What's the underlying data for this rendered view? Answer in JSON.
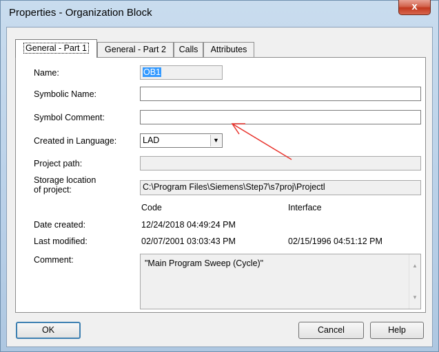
{
  "window": {
    "title": "Properties - Organization Block",
    "close_glyph": "x"
  },
  "tabs": [
    {
      "label": "General - Part 1",
      "active": true
    },
    {
      "label": "General - Part 2",
      "active": false
    },
    {
      "label": "Calls",
      "active": false
    },
    {
      "label": "Attributes",
      "active": false
    }
  ],
  "form": {
    "name_label": "Name:",
    "name_value": "OB1",
    "symbolic_name_label": "Symbolic Name:",
    "symbolic_name_value": "",
    "symbol_comment_label": "Symbol Comment:",
    "symbol_comment_value": "",
    "created_language_label": "Created in Language:",
    "created_language_value": "LAD",
    "project_path_label": "Project path:",
    "project_path_value": "",
    "storage_label_line1": "Storage location",
    "storage_label_line2": "of project:",
    "storage_value": "C:\\Program Files\\Siemens\\Step7\\s7proj\\Projectl",
    "code_header": "Code",
    "interface_header": "Interface",
    "date_created_label": "Date created:",
    "date_created_code": "12/24/2018 04:49:24 PM",
    "last_modified_label": "Last modified:",
    "last_modified_code": "02/07/2001 03:03:43 PM",
    "last_modified_interface": "02/15/1996 04:51:12 PM",
    "comment_label": "Comment:",
    "comment_value": "\"Main Program Sweep (Cycle)\""
  },
  "buttons": {
    "ok": "OK",
    "cancel": "Cancel",
    "help": "Help"
  },
  "annotation": {
    "arrow_color": "#e8312a"
  },
  "icons": {
    "combo": "chevron-down-icon",
    "scroll_up": "scroll-up-arrow-icon",
    "scroll_down": "scroll-down-arrow-icon"
  }
}
